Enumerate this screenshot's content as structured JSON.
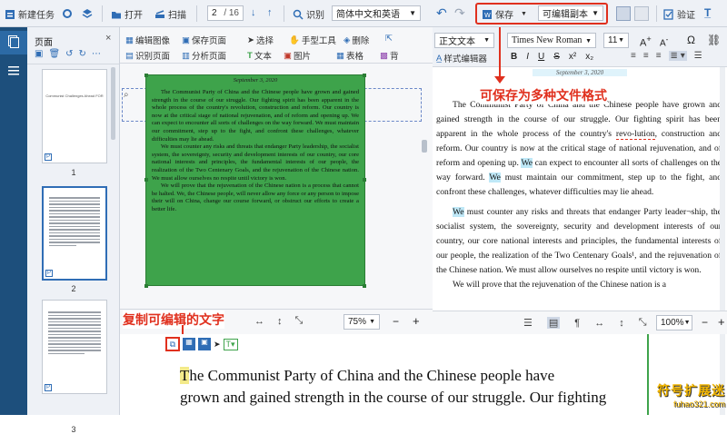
{
  "toolbar": {
    "new_task": "新建任务",
    "open": "打开",
    "scan": "扫描",
    "page_current": "2",
    "page_total": "/ 16",
    "recognize": "识别",
    "language": "简体中文和英语",
    "save": "保存",
    "save_format": "可编辑副本",
    "verify": "验证"
  },
  "page_panel": {
    "title": "页面",
    "thumbs": [
      "1",
      "2",
      "3"
    ],
    "thumb1_caption": "Communist Challenges Ahead FOR"
  },
  "image_tools": {
    "edit_image": "编辑图像",
    "save_page": "保存页面",
    "select": "选择",
    "hand_tool": "手型工具",
    "delete": "删除",
    "recognize_page": "识别页面",
    "analyze_page": "分析页面",
    "text": "文本",
    "picture": "图片",
    "table": "表格",
    "background": "背"
  },
  "scan_page": {
    "date": "September 3, 2020",
    "paragraphs": [
      "The Communist Party of China and the Chinese people have grown and gained strength in the course of our struggle. Our fighting spirit has been apparent in the whole process of the country's revolution, construction and reform. Our country is now at the critical stage of national rejuvenation, and of reform and opening up. We can expect to encounter all sorts of challenges on the way forward. We must maintain our commitment, step up to the fight, and confront these challenges, whatever difficulties may lie ahead.",
      "We must counter any risks and threats that endanger Party leadership, the socialist system, the sovereignty, security and development interests of our country, our core national interests and principles, the fundamental interests of our people, the realization of the Two Centenary Goals, and the rejuvenation of the Chinese nation. We must allow ourselves no respite until victory is won.",
      "We will prove that the rejuvenation of the Chinese nation is a process that cannot be halted. We, the Chinese people, will never allow any force or any person to impose their will on China, change our course forward, or obstruct our efforts to create a better life."
    ]
  },
  "text_editor": {
    "style": "正文文本",
    "font": "Times New Roman",
    "size": "11",
    "style_editor": "样式编辑器",
    "date": "September 3, 2020",
    "p1_a": "The Communist Party of China and the Chinese people have grown and gained strength in the course of our struggle. Our fighting spirit has been apparent in the whole process of the country's ",
    "p1_revo": "revo-lution",
    "p1_b": ", construction and reform. Our country is now at the critical stage of national rejuvenation, and of reform and opening up. ",
    "p1_we1": "We",
    "p1_c": " can expect to encounter all sorts of challenges on the way forward. ",
    "p1_we2": "We",
    "p1_d": " must maintain our commitment, step up to the fight, and confront these challenges, whatever difficulties may lie ahead.",
    "p2_we": "We",
    "p2": " must counter any risks and threats that endanger Party leader¬ship, the socialist system, the sovereignty, security and development interests of our country, our core national interests and principles, the fundamental interests of our people, the realization of the Two Centenary Goals¹, and the rejuvenation of the Chinese nation. We must allow ourselves no respite until victory is won.",
    "p3": "We will prove that the rejuvenation of the Chinese nation is a"
  },
  "zoom": {
    "left": "75%",
    "right": "100%"
  },
  "bottom_text": {
    "line1_cursor": "T",
    "line1": "he Communist Party of China and the Chinese people have",
    "line2": "grown and gained strength in the course of our struggle. Our fighting"
  },
  "annotations": {
    "save_formats": "可保存为多种文件格式",
    "copy_text": "复制可编辑的文字"
  },
  "watermark": {
    "text": "符号扩展迷",
    "url": "fuhao321.com"
  }
}
